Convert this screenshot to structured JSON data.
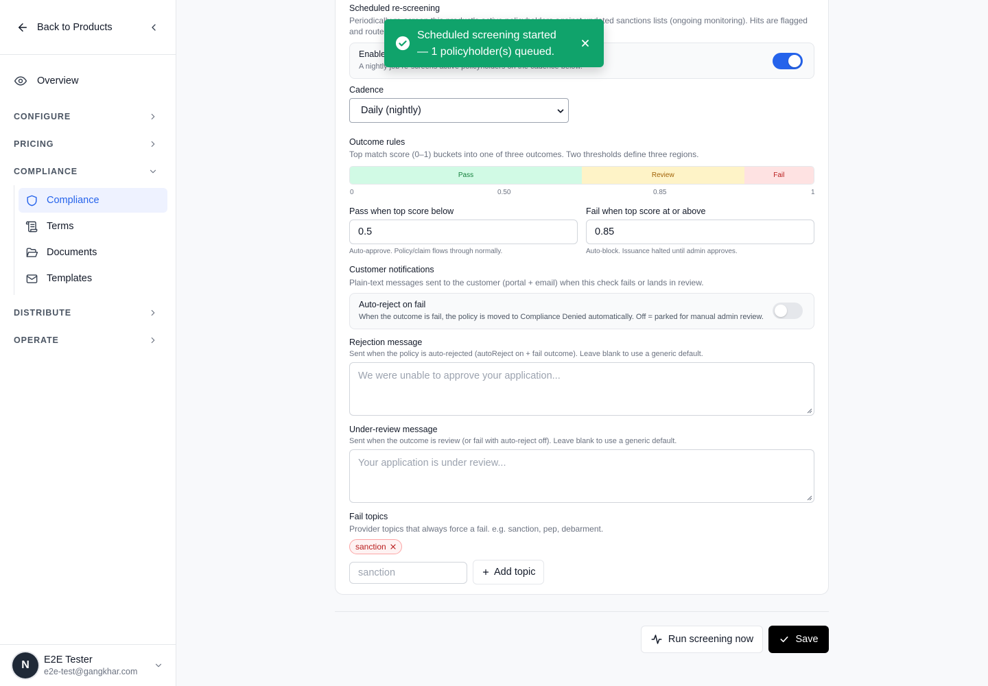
{
  "sidebar": {
    "back_label": "Back to Products",
    "overview_label": "Overview",
    "sections": {
      "configure": "CONFIGURE",
      "pricing": "PRICING",
      "compliance": "COMPLIANCE",
      "distribute": "DISTRIBUTE",
      "operate": "OPERATE"
    },
    "compliance_items": [
      "Compliance",
      "Terms",
      "Documents",
      "Templates"
    ],
    "active_item": "Compliance",
    "user": {
      "initial": "N",
      "name": "E2E Tester",
      "email": "e2e-test@gangkhar.com"
    }
  },
  "rescreening": {
    "title": "Scheduled re-screening",
    "desc_line1": "Periodically re-screen this product's active policyholders against updated sanctions lists (ongoing monitoring). Hits are flagged",
    "desc_line2": "and routed to review.",
    "enable_label": "Enable",
    "enable_help": "A nightly job re-screens active policyholders on the cadence below.",
    "enabled": true,
    "cadence_label": "Cadence",
    "cadence_value": "Daily (nightly)"
  },
  "outcome": {
    "title": "Outcome rules",
    "desc": "Top match score (0–1) buckets into one of three outcomes. Two thresholds define three regions.",
    "pass_label": "Pass",
    "review_label": "Review",
    "fail_label": "Fail",
    "ticks": [
      "0",
      "0.50",
      "0.85",
      "1"
    ],
    "pass_threshold": 0.5,
    "fail_threshold": 0.85,
    "pass_field_label": "Pass when top score below",
    "pass_field_value": "0.5",
    "pass_field_help": "Auto-approve. Policy/claim flows through normally.",
    "fail_field_label": "Fail when top score at or above",
    "fail_field_value": "0.85",
    "fail_field_help": "Auto-block. Issuance halted until admin approves.",
    "colors": {
      "pass_bg": "#d1fae5",
      "pass_text": "#15803d",
      "review_bg": "#fef3c7",
      "review_text": "#a16207",
      "fail_bg": "#fee2e2",
      "fail_text": "#b91c1c"
    }
  },
  "notifications": {
    "title": "Customer notifications",
    "desc": "Plain-text messages sent to the customer (portal + email) when this check fails or lands in review.",
    "auto_reject_label": "Auto-reject on fail",
    "auto_reject_help": "When the outcome is fail, the policy is moved to Compliance Denied automatically. Off = parked for manual admin review.",
    "auto_reject_enabled": false,
    "rejection_label": "Rejection message",
    "rejection_help": "Sent when the policy is auto-rejected (autoReject on + fail outcome). Leave blank to use a generic default.",
    "rejection_placeholder": "We were unable to approve your application...",
    "review_label": "Under-review message",
    "review_help": "Sent when the outcome is review (or fail with auto-reject off). Leave blank to use a generic default.",
    "review_placeholder": "Your application is under review..."
  },
  "fail_topics": {
    "title": "Fail topics",
    "desc": "Provider topics that always force a fail. e.g. sanction, pep, debarment.",
    "topics": [
      "sanction"
    ],
    "input_placeholder": "sanction",
    "add_label": "Add topic"
  },
  "actions": {
    "run_label": "Run screening now",
    "save_label": "Save"
  },
  "toast": {
    "line1": "Scheduled screening started",
    "line2": "— 1 policyholder(s) queued."
  },
  "accent": "#2563eb",
  "toast_color": "#10a36b"
}
